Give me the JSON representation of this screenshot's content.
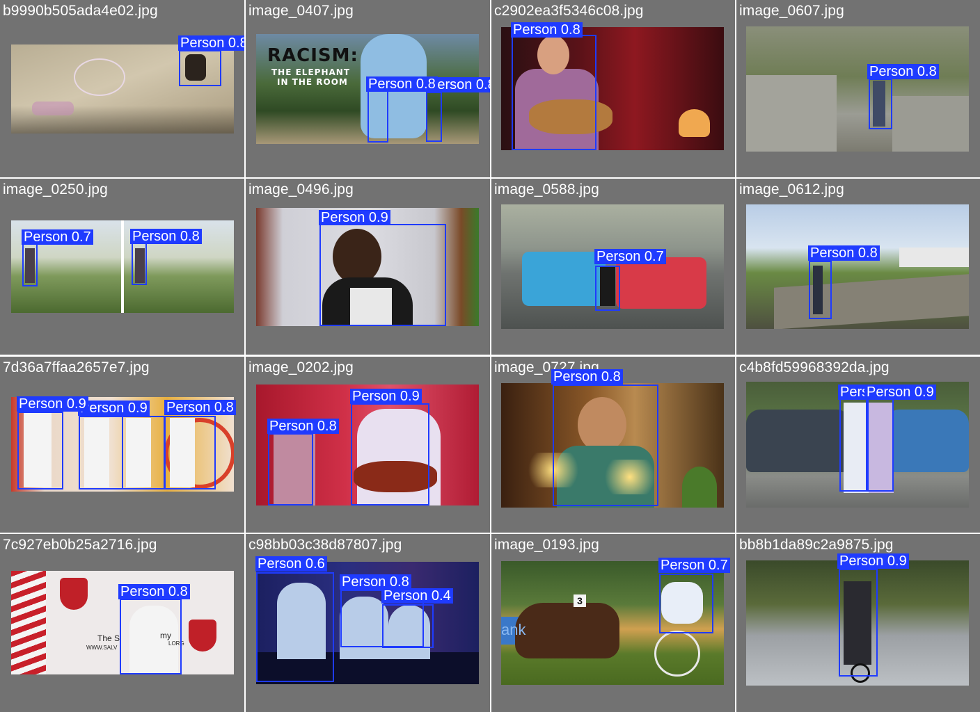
{
  "grid": {
    "tiles": [
      {
        "filename": "b9990b505ada4e02.jpg",
        "detections": [
          {
            "label": "Person 0.8"
          }
        ]
      },
      {
        "filename": "image_0407.jpg",
        "scene_text": [
          "RACISM:",
          "THE ELEPHANT",
          "IN THE ROOM"
        ],
        "detections": [
          {
            "label": "Person 0.8"
          },
          {
            "label": "Person 0.8"
          }
        ]
      },
      {
        "filename": "c2902ea3f5346c08.jpg",
        "detections": [
          {
            "label": "Person 0.8"
          }
        ]
      },
      {
        "filename": "image_0607.jpg",
        "detections": [
          {
            "label": "Person 0.8"
          }
        ]
      },
      {
        "filename": "image_0250.jpg",
        "detections": [
          {
            "label": "Person 0.7"
          },
          {
            "label": "Person 0.8"
          }
        ]
      },
      {
        "filename": "image_0496.jpg",
        "detections": [
          {
            "label": "Person 0.9"
          }
        ]
      },
      {
        "filename": "image_0588.jpg",
        "detections": [
          {
            "label": "Person 0.7"
          }
        ]
      },
      {
        "filename": "image_0612.jpg",
        "detections": [
          {
            "label": "Person 0.8"
          }
        ]
      },
      {
        "filename": "7d36a7ffaa2657e7.jpg",
        "detections": [
          {
            "label": "Person 0.9"
          },
          {
            "label": "Person 0.9"
          },
          {
            "label": "Person 0.8"
          }
        ]
      },
      {
        "filename": "image_0202.jpg",
        "detections": [
          {
            "label": "Person 0.9"
          },
          {
            "label": "Person 0.8"
          }
        ]
      },
      {
        "filename": "image_0727.jpg",
        "detections": [
          {
            "label": "Person 0.8"
          }
        ]
      },
      {
        "filename": "c4b8fd59968392da.jpg",
        "detections": [
          {
            "label": "Person 0.9"
          },
          {
            "label": "Person 0.9"
          }
        ]
      },
      {
        "filename": "7c927eb0b25a2716.jpg",
        "scene_text": [
          "The S",
          "my",
          "WWW.SALV",
          "LORG"
        ],
        "detections": [
          {
            "label": "Person 0.8"
          }
        ]
      },
      {
        "filename": "c98bb03c38d87807.jpg",
        "detections": [
          {
            "label": "Person 0.6"
          },
          {
            "label": "Person 0.8"
          },
          {
            "label": "Person 0.4"
          }
        ]
      },
      {
        "filename": "image_0193.jpg",
        "scene_text": [
          "3",
          "ank"
        ],
        "detections": [
          {
            "label": "Person 0.7"
          }
        ]
      },
      {
        "filename": "bb8b1da89c2a9875.jpg",
        "detections": [
          {
            "label": "Person 0.9"
          }
        ]
      }
    ]
  },
  "colors": {
    "tile_bg": "#727272",
    "box": "#1f3bff",
    "label_text": "#ffffff"
  }
}
